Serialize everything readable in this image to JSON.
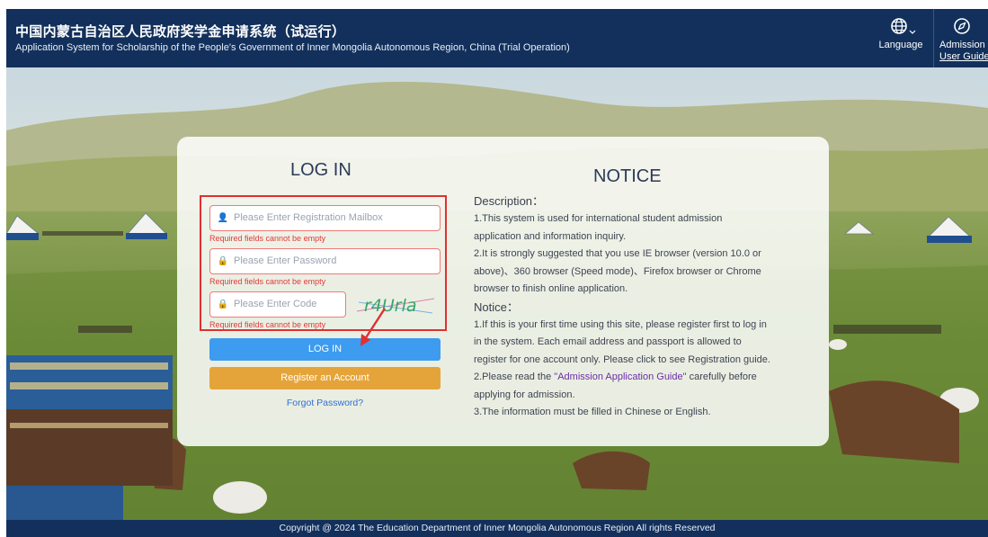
{
  "header": {
    "title_zh": "中国内蒙古自治区人民政府奖学金申请系统（试运行）",
    "title_en": "Application System for Scholarship of the People's Government of Inner Mongolia Autonomous Region, China (Trial Operation)",
    "language_label": "Language",
    "guide_label_line1": "Admission",
    "guide_label_line2": "User Guide",
    "icons": {
      "language": "globe-icon",
      "dropdown": "chevron-down-icon",
      "guide": "compass-icon"
    }
  },
  "login": {
    "title": "LOG IN",
    "mailbox_placeholder": "Please Enter Registration Mailbox",
    "password_placeholder": "Please Enter Password",
    "code_placeholder": "Please Enter Code",
    "required_error": "Required fields cannot be empty",
    "captcha_text": "r4Urla",
    "login_button": "LOG IN",
    "register_button": "Register an Account",
    "forgot_link": "Forgot Password?"
  },
  "notice": {
    "title": "NOTICE",
    "description_heading": "Description：",
    "desc_lines": [
      "1.This system is used for international student admission",
      "application and information inquiry.",
      "2.It is strongly suggested that you use IE browser (version 10.0 or",
      "above)、360 browser (Speed mode)、Firefox browser or Chrome",
      "browser to finish online application."
    ],
    "notice_heading": "Notice：",
    "notice_lines": [
      "1.If this is your first time using this site, please register first to log in",
      "in the system. Each email address and passport is allowed to",
      "register for one account only. Please click to see Registration guide."
    ],
    "guide_prefix": "2.Please read the ",
    "guide_link": "\"Admission Application Guide\"",
    "guide_suffix": " carefully before",
    "tail_lines": [
      "applying for admission.",
      "3.The information must be filled in Chinese or English."
    ]
  },
  "footer": {
    "copyright": "Copyright @ 2024 The Education Department of Inner Mongolia Autonomous Region All rights Reserved"
  },
  "colors": {
    "header_bg": "#12305b",
    "login_button": "#3d9bf0",
    "register_button": "#e5a43a",
    "error_red": "#e03030",
    "guide_link": "#6a2da8"
  }
}
